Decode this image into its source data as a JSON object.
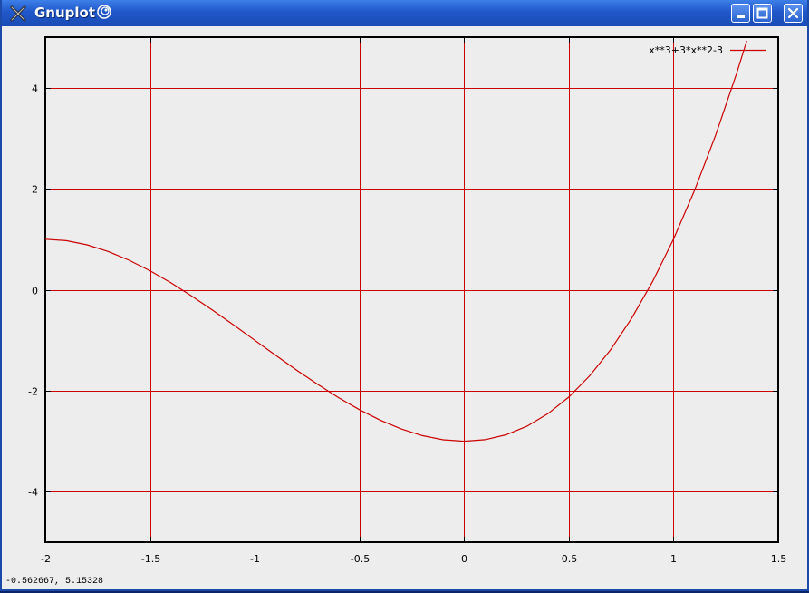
{
  "window": {
    "title": "Gnuplot"
  },
  "status": {
    "coordinates": "-0.562667,  5.15328"
  },
  "chart_data": {
    "type": "line",
    "title": "",
    "xlabel": "",
    "ylabel": "",
    "xlim": [
      -2,
      1.5
    ],
    "ylim": [
      -5,
      5
    ],
    "grid": true,
    "legend_position": "top-right",
    "x_ticks": [
      "-2",
      "-1.5",
      "-1",
      "-0.5",
      "0",
      "0.5",
      "1",
      "1.5"
    ],
    "y_ticks": [
      "-4",
      "-2",
      "0",
      "2",
      "4"
    ],
    "series": [
      {
        "name": "x**3+3*x**2-3",
        "color": "#cc0000",
        "x": [
          -2.0,
          -1.9,
          -1.8,
          -1.7,
          -1.6,
          -1.5,
          -1.4,
          -1.3,
          -1.2,
          -1.1,
          -1.0,
          -0.9,
          -0.8,
          -0.7,
          -0.6,
          -0.5,
          -0.4,
          -0.3,
          -0.2,
          -0.1,
          0.0,
          0.1,
          0.2,
          0.3,
          0.4,
          0.5,
          0.6,
          0.7,
          0.8,
          0.9,
          1.0,
          1.1,
          1.2,
          1.3,
          1.35
        ],
        "y": [
          1.0,
          0.971,
          0.888,
          0.757,
          0.584,
          0.375,
          0.136,
          -0.127,
          -0.408,
          -0.701,
          -1.0,
          -1.299,
          -1.592,
          -1.873,
          -2.136,
          -2.375,
          -2.584,
          -2.757,
          -2.888,
          -2.971,
          -3.0,
          -2.969,
          -2.872,
          -2.703,
          -2.456,
          -2.125,
          -1.704,
          -1.187,
          -0.568,
          0.159,
          1.0,
          1.961,
          3.048,
          4.267,
          4.928
        ]
      }
    ]
  }
}
